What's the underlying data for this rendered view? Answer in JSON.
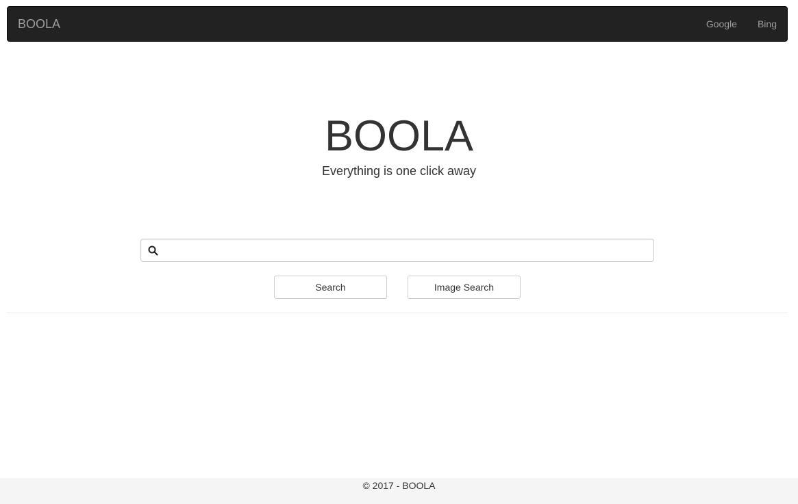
{
  "navbar": {
    "brand": "BOOLA",
    "links": [
      {
        "label": "Google"
      },
      {
        "label": "Bing"
      }
    ]
  },
  "hero": {
    "title": "BOOLA",
    "subtitle": "Everything is one click away"
  },
  "search": {
    "value": "",
    "placeholder": "",
    "icon": "search-icon"
  },
  "buttons": {
    "search_label": "Search",
    "image_search_label": "Image Search"
  },
  "footer": {
    "text": "© 2017 - BOOLA"
  }
}
